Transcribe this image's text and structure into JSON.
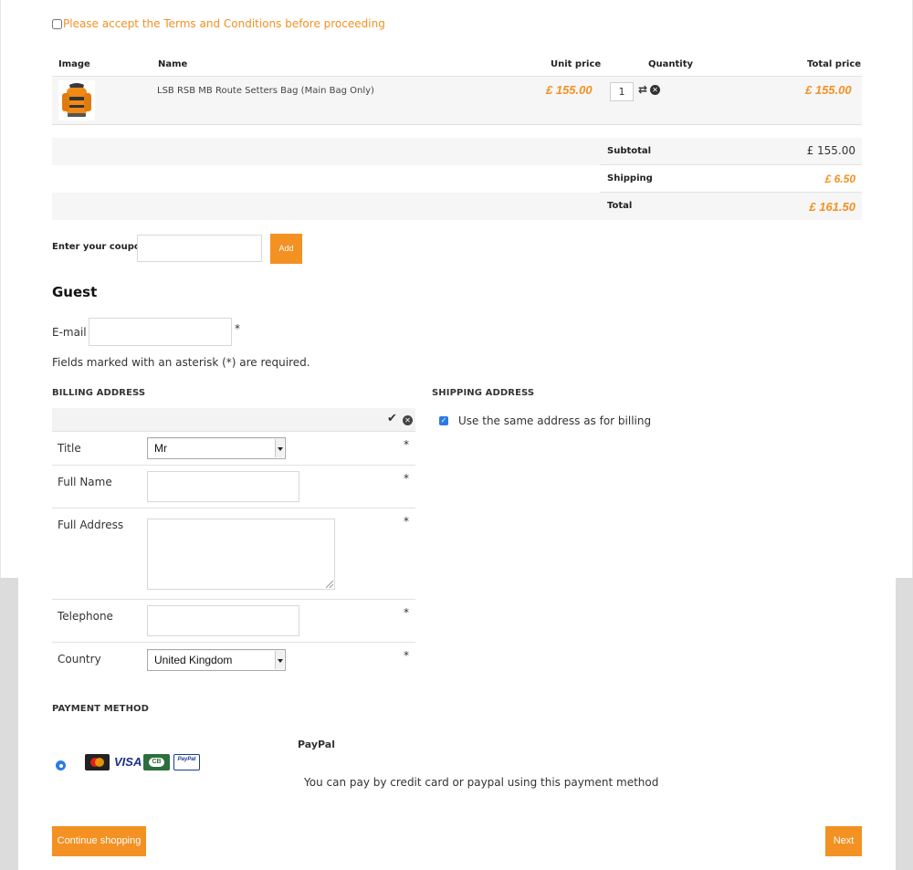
{
  "terms": {
    "label": "Please accept the Terms and Conditions before proceeding"
  },
  "cart": {
    "headers": {
      "image": "Image",
      "name": "Name",
      "unit_price": "Unit price",
      "quantity": "Quantity",
      "total_price": "Total price"
    },
    "items": [
      {
        "name": "LSB RSB MB Route Setters Bag (Main Bag Only)",
        "unit_price": "£ 155.00",
        "quantity": "1",
        "total_price": "£ 155.00",
        "image_icon": "orange-backpack-image"
      }
    ],
    "totals": {
      "subtotal_label": "Subtotal",
      "subtotal_value": "£ 155.00",
      "shipping_label": "Shipping",
      "shipping_value": "£ 6.50",
      "total_label": "Total",
      "total_value": "£ 161.50"
    }
  },
  "coupon": {
    "label": "Enter your coupon",
    "value": "",
    "button": "Add"
  },
  "guest": {
    "title": "Guest",
    "email_label": "E-mail",
    "email_value": "",
    "required_star": "*",
    "required_note": "Fields marked with an asterisk (*) are required."
  },
  "billing": {
    "heading": "BILLING ADDRESS",
    "fields": {
      "title_label": "Title",
      "title_value": "Mr",
      "fullname_label": "Full Name",
      "fullname_value": "",
      "address_label": "Full Address",
      "address_value": "",
      "telephone_label": "Telephone",
      "telephone_value": "",
      "country_label": "Country",
      "country_value": "United Kingdom"
    }
  },
  "shipping": {
    "heading": "SHIPPING ADDRESS",
    "same_as_billing": "Use the same address as for billing",
    "same_checked": true
  },
  "payment": {
    "heading": "PAYMENT METHOD",
    "method_name": "PayPal",
    "description": "You can pay by credit card or paypal using this payment method",
    "cards": {
      "mastercard": "MasterCard",
      "visa": "VISA",
      "cb": "CB",
      "paypal": "PayPal"
    }
  },
  "buttons": {
    "continue": "Continue shopping",
    "next": "Next"
  },
  "colors": {
    "accent": "#f39122",
    "checkbox_blue": "#2c7be5",
    "row_bg": "#f6f6f6",
    "side_band": "#dcdcdc"
  }
}
